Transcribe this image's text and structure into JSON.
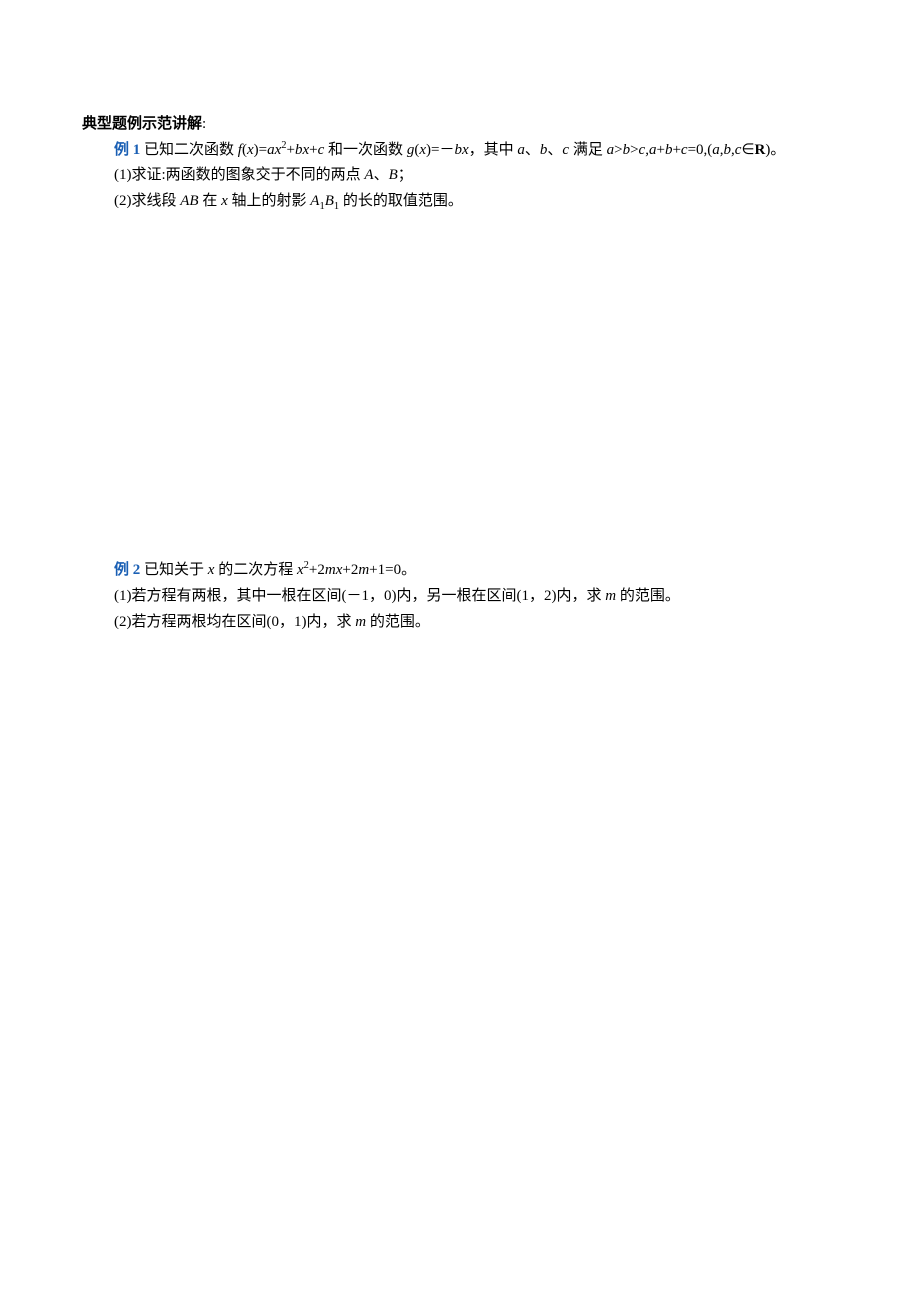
{
  "section": {
    "title": "典型题例示范讲解",
    "colon": ":"
  },
  "ex1": {
    "label": "例 1 ",
    "a": "已知二次函数 ",
    "b": "f",
    "c": "(",
    "d": "x",
    "e": ")=",
    "f": "ax",
    "g": "2",
    "h": "+",
    "i": "bx",
    "j": "+",
    "k": "c",
    "l": " 和一次函数 ",
    "m": "g",
    "n": "(",
    "o": "x",
    "p": ")=－",
    "q": "bx",
    "r": "，其中 ",
    "s": "a",
    "t": "、",
    "u": "b",
    "v": "、",
    "w": "c",
    "x": " 满足 ",
    "y": "a",
    "z": ">",
    "aa": "b",
    "ab": ">",
    "ac": "c",
    "ad": ",",
    "ae": "a",
    "af": "+",
    "ag": "b",
    "ah": "+",
    "ai": "c",
    "aj": "=0,(",
    "ak": "a",
    "al": ",",
    "am": "b",
    "an": ",",
    "ao": "c",
    "ap": "∈",
    "aq": "R",
    "ar": ")",
    "as": "。"
  },
  "ex1p1": {
    "a": "(1)求证:两函数的图象交于不同的两点 ",
    "b": "A",
    "c": "、",
    "d": "B",
    "e": "；"
  },
  "ex1p2": {
    "a": "(2)求线段 ",
    "b": "AB",
    "c": " 在 ",
    "d": "x",
    "e": " 轴上的射影 ",
    "f": "A",
    "g": "1",
    "h": "B",
    "i": "1",
    "j": " 的长的取值范围",
    "k": "。"
  },
  "ex2": {
    "label": "例 2 ",
    "a": "已知关于 ",
    "b": "x",
    "c": " 的二次方程 ",
    "d": "x",
    "e": "2",
    "f": "+2",
    "g": "mx",
    "h": "+2",
    "i": "m",
    "j": "+1=0",
    "k": "。"
  },
  "ex2p1": {
    "a": "(1)若方程有两根，其中一根在区间(－1，0)内，另一根在区间(1，2)内，求 ",
    "b": "m",
    "c": " 的范围",
    "d": "。"
  },
  "ex2p2": {
    "a": "(2)若方程两根均在区间(0，1)内，求 ",
    "b": "m",
    "c": " 的范围",
    "d": "。"
  }
}
